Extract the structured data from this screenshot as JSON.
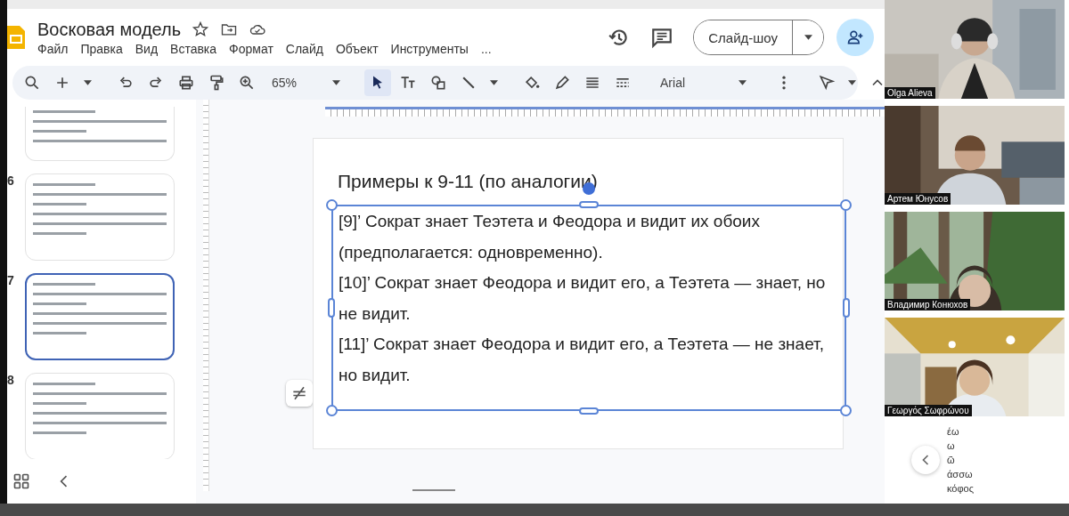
{
  "document": {
    "title": "Восковая модель"
  },
  "menu": [
    "Файл",
    "Правка",
    "Вид",
    "Вставка",
    "Формат",
    "Слайд",
    "Объект",
    "Инструменты",
    "..."
  ],
  "slideshow_button": "Слайд-шоу",
  "toolbar": {
    "zoom": "65%",
    "font": "Arial"
  },
  "slides": [
    {
      "selected": false
    },
    {
      "number": "6",
      "selected": false
    },
    {
      "number": "7",
      "selected": true
    },
    {
      "number": "8",
      "selected": false
    }
  ],
  "slide": {
    "title": "Примеры к 9-11 (по аналогии)",
    "paragraphs": [
      "[9]’ Сократ знает Теэтета и Феодора и видит их обоих (предполагается: одновременно).",
      "[10]’ Сократ знает Феодора и видит его, а Теэтета — знает, но не видит.",
      "[11]’ Сократ знает Феодора и видит его, а Теэтета — не знает, но видит."
    ]
  },
  "participants": [
    {
      "name": "Olga Alieva"
    },
    {
      "name": "Артем Юнусов"
    },
    {
      "name": "Владимир Конюхов"
    },
    {
      "name": "Γεωργός Σωφρώνου"
    }
  ],
  "background_words": [
    "έω",
    "ω",
    "ῶ",
    "άσσω",
    "κόφος"
  ]
}
